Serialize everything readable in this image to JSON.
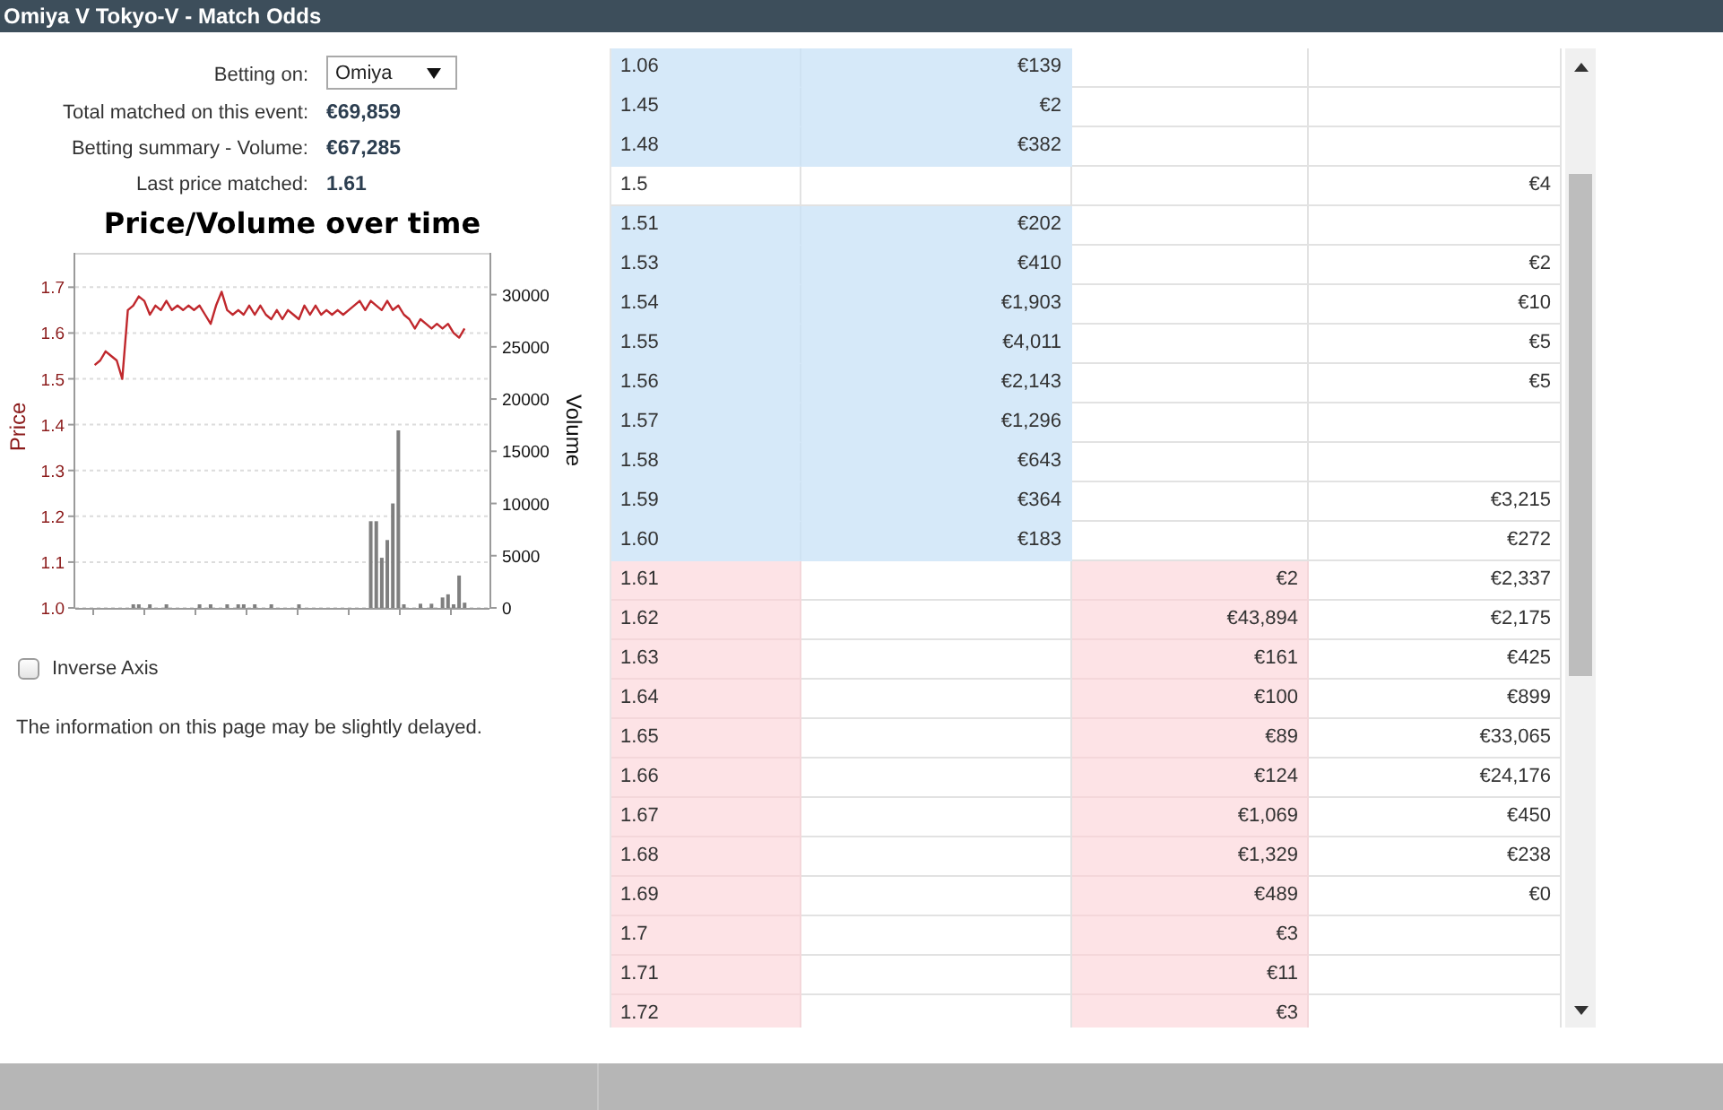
{
  "window": {
    "title": "Omiya V Tokyo-V - Match Odds"
  },
  "info_panel": {
    "betting_on": {
      "label": "Betting on:",
      "value": "Omiya"
    },
    "stats": [
      {
        "label": "Total matched on this event:",
        "value": "€69,859"
      },
      {
        "label": "Betting summary - Volume:",
        "value": "€67,285"
      },
      {
        "label": "Last price matched:",
        "value": "1.61"
      }
    ]
  },
  "chart": {
    "title": "Price/Volume over time",
    "price": {
      "chart_data": {
        "type": "line",
        "grid": true,
        "categories": [
          null,
          null,
          null,
          null,
          null,
          null,
          null,
          null,
          null,
          null,
          null,
          null,
          null,
          null,
          null,
          null,
          null,
          null,
          null,
          null,
          null,
          null,
          null,
          null,
          null,
          null,
          null,
          null,
          null,
          null,
          null,
          null,
          null,
          null,
          null,
          null,
          null,
          null,
          null,
          null,
          null,
          null,
          null,
          null,
          null,
          null,
          null,
          null,
          null,
          null,
          null,
          null,
          null,
          null,
          null,
          null,
          null,
          null,
          null,
          null,
          null,
          null,
          null,
          null,
          null,
          null,
          null,
          null,
          null,
          null,
          null,
          null,
          null,
          null,
          null
        ],
        "ylim": [
          1,
          1.775
        ],
        "yticks": [
          {
            "value": 1,
            "label": "1.0"
          },
          1.1,
          1.2,
          1.3,
          1.4,
          1.5,
          1.6,
          1.7
        ],
        "series": [
          {
            "name": "Price",
            "color": "#c0282d",
            "values": [
              null,
              null,
              null,
              1.53,
              1.54,
              1.56,
              1.55,
              1.54,
              1.5,
              1.65,
              1.66,
              1.68,
              1.67,
              1.64,
              1.66,
              1.65,
              1.67,
              1.65,
              1.66,
              1.65,
              1.66,
              1.65,
              1.66,
              1.64,
              1.62,
              1.66,
              1.69,
              1.65,
              1.64,
              1.65,
              1.64,
              1.66,
              1.64,
              1.66,
              1.64,
              1.63,
              1.65,
              1.63,
              1.65,
              1.64,
              1.63,
              1.66,
              1.64,
              1.66,
              1.64,
              1.65,
              1.64,
              1.65,
              1.64,
              1.65,
              1.66,
              1.67,
              1.65,
              1.67,
              1.66,
              1.65,
              1.67,
              1.65,
              1.66,
              1.64,
              1.63,
              1.61,
              1.63,
              1.62,
              1.61,
              1.62,
              1.61,
              1.62,
              1.6,
              1.59,
              1.61,
              null,
              null,
              null,
              null
            ]
          }
        ]
      }
    },
    "volume": {
      "chart_data": {
        "type": "bar",
        "categories": [
          null,
          null,
          null,
          null,
          null,
          null,
          null,
          null,
          null,
          null,
          null,
          null,
          null,
          null,
          null,
          null,
          null,
          null,
          null,
          null,
          null,
          null,
          null,
          null,
          null,
          null,
          null,
          null,
          null,
          null,
          null,
          null,
          null,
          null,
          null,
          null,
          null,
          null,
          null,
          null,
          null,
          null,
          null,
          null,
          null,
          null,
          null,
          null,
          null,
          null,
          null,
          null,
          null,
          null,
          null,
          null,
          null,
          null,
          null,
          null,
          null,
          null,
          null,
          null,
          null,
          null,
          null,
          null,
          null,
          null,
          null,
          null,
          null,
          null,
          null
        ],
        "ylim": [
          0,
          34000
        ],
        "yticks": [
          0,
          5000,
          10000,
          15000,
          20000,
          25000,
          30000
        ],
        "series": [
          {
            "name": "Volume",
            "color": "#7f7f7f",
            "values": [
              null,
              null,
              null,
              0,
              0,
              0,
              0,
              0,
              0,
              0,
              300,
              300,
              0,
              100,
              0,
              0,
              100,
              0,
              0,
              0,
              0,
              0,
              200,
              0,
              300,
              0,
              0,
              200,
              0,
              300,
              300,
              0,
              200,
              0,
              0,
              100,
              0,
              0,
              0,
              0,
              100,
              0,
              0,
              0,
              0,
              0,
              0,
              0,
              0,
              0,
              0,
              0,
              0,
              8300,
              8300,
              4800,
              6500,
              10000,
              17000,
              300,
              0,
              0,
              400,
              0,
              400,
              0,
              1000,
              1300,
              300,
              3100,
              500,
              null,
              null,
              null,
              null
            ]
          }
        ]
      }
    }
  },
  "inverse_axis": {
    "label": "Inverse Axis",
    "checked": false
  },
  "notice": "The information on this page may be slightly delayed.",
  "ladder": {
    "rows": [
      {
        "kind": "back",
        "column_1": "1.06",
        "column_2": "€139"
      },
      {
        "kind": "back",
        "column_1": "1.45",
        "column_2": "€2"
      },
      {
        "kind": "back",
        "column_1": "1.48",
        "column_2": "€382"
      },
      {
        "kind": "plain",
        "column_1": "1.5",
        "column_4": "€4"
      },
      {
        "kind": "back",
        "column_1": "1.51",
        "column_2": "€202"
      },
      {
        "kind": "back",
        "column_1": "1.53",
        "column_2": "€410",
        "column_4": "€2"
      },
      {
        "kind": "back",
        "column_1": "1.54",
        "column_2": "€1,903",
        "column_4": "€10"
      },
      {
        "kind": "back",
        "column_1": "1.55",
        "column_2": "€4,011",
        "column_4": "€5"
      },
      {
        "kind": "back",
        "column_1": "1.56",
        "column_2": "€2,143",
        "column_4": "€5"
      },
      {
        "kind": "back",
        "column_1": "1.57",
        "column_2": "€1,296"
      },
      {
        "kind": "back",
        "column_1": "1.58",
        "column_2": "€643"
      },
      {
        "kind": "back",
        "column_1": "1.59",
        "column_2": "€364",
        "column_4": "€3,215"
      },
      {
        "kind": "back",
        "column_1": "1.60",
        "column_2": "€183",
        "column_4": "€272"
      },
      {
        "kind": "lay",
        "column_1": "1.61",
        "column_3": "€2",
        "column_4": "€2,337"
      },
      {
        "kind": "lay",
        "column_1": "1.62",
        "column_3": "€43,894",
        "column_4": "€2,175"
      },
      {
        "kind": "lay",
        "column_1": "1.63",
        "column_3": "€161",
        "column_4": "€425"
      },
      {
        "kind": "lay",
        "column_1": "1.64",
        "column_3": "€100",
        "column_4": "€899"
      },
      {
        "kind": "lay",
        "column_1": "1.65",
        "column_3": "€89",
        "column_4": "€33,065"
      },
      {
        "kind": "lay",
        "column_1": "1.66",
        "column_3": "€124",
        "column_4": "€24,176"
      },
      {
        "kind": "lay",
        "column_1": "1.67",
        "column_3": "€1,069",
        "column_4": "€450"
      },
      {
        "kind": "lay",
        "column_1": "1.68",
        "column_3": "€1,329",
        "column_4": "€238"
      },
      {
        "kind": "lay",
        "column_1": "1.69",
        "column_3": "€489",
        "column_4": "€0"
      },
      {
        "kind": "lay",
        "column_1": "1.7",
        "column_3": "€3"
      },
      {
        "kind": "lay",
        "column_1": "1.71",
        "column_3": "€11"
      },
      {
        "kind": "lay",
        "column_1": "1.72",
        "column_3": "€3"
      }
    ]
  }
}
